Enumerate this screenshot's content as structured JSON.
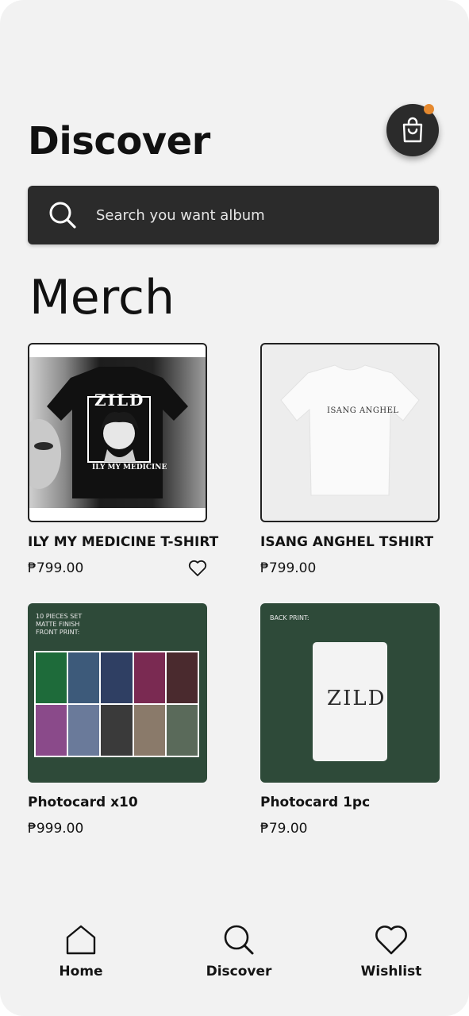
{
  "header": {
    "title": "Discover"
  },
  "cart": {
    "icon": "shopping-bag-icon",
    "badge_color": "#e5892f"
  },
  "search": {
    "placeholder": "Search you want album",
    "icon": "search-icon"
  },
  "section": {
    "title": "Merch"
  },
  "products": [
    {
      "name": "ILY MY MEDICINE T-SHIRT",
      "price": "₱799.00",
      "shirt_band": "ZILD",
      "shirt_caption": "ILY MY MEDICINE",
      "wishlist_icon": "heart-icon"
    },
    {
      "name": "ISANG ANGHEL TSHIRT",
      "price": "₱799.00",
      "shirt_print": "ISANG ANGHEL"
    },
    {
      "name": "Photocard x10",
      "price": "₱999.00",
      "card_text": [
        "10 PIECES SET",
        "MATTE FINISH",
        "FRONT PRINT:"
      ]
    },
    {
      "name": "Photocard 1pc",
      "price": "₱79.00",
      "card_text": "BACK PRINT:",
      "card_logo": "ZILD"
    }
  ],
  "nav": {
    "items": [
      {
        "label": "Home",
        "icon": "home-icon"
      },
      {
        "label": "Discover",
        "icon": "search-icon"
      },
      {
        "label": "Wishlist",
        "icon": "heart-icon"
      }
    ]
  },
  "colors": {
    "background": "#f2f2f2",
    "dark": "#2b2b2b",
    "accent": "#e5892f"
  }
}
